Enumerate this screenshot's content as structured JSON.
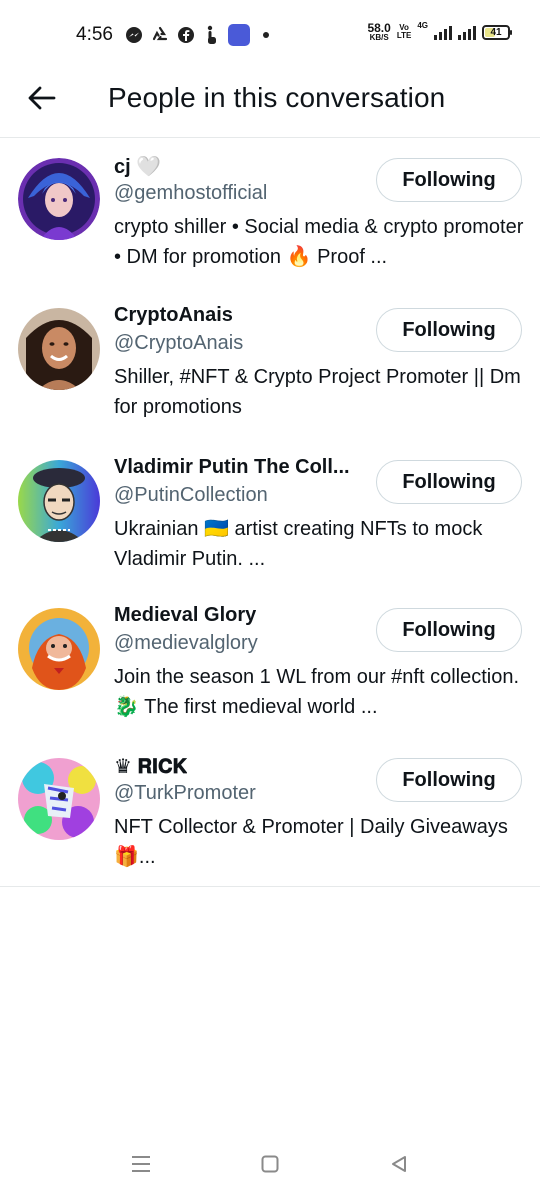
{
  "status_bar": {
    "time": "4:56",
    "net_speed": "58.0",
    "net_speed_unit": "KB/S",
    "volte_top": "Vo",
    "volte_bottom": "LTE",
    "network_type": "4G",
    "battery_level": "41",
    "battery_fraction": 0.41,
    "notification_icons": [
      "messenger-icon",
      "recycle-icon",
      "facebook-icon",
      "tap-hand-icon",
      "app-icon"
    ]
  },
  "header": {
    "title": "People in this conversation",
    "back_icon": "arrow-left-icon"
  },
  "colors": {
    "text_primary": "#0f1419",
    "text_secondary": "#536471",
    "button_border": "#cfd9de",
    "divider": "#e6e9ea"
  },
  "users": [
    {
      "name": "cj 🤍",
      "handle": "@gemhostofficial",
      "bio": "crypto shiller • Social media & crypto promoter • DM for promotion 🔥 Proof ...",
      "button": "Following",
      "avatar": "anime-avatar"
    },
    {
      "name": "CryptoAnais",
      "handle": "@CryptoAnais",
      "bio": "Shiller, #NFT & Crypto Project Promoter || Dm for promotions",
      "button": "Following",
      "avatar": "photo-avatar"
    },
    {
      "name": "Vladimir Putin The Coll...",
      "handle": "@PutinCollection",
      "bio": "Ukrainian 🇺🇦 artist creating NFTs to mock Vladimir Putin. ...",
      "button": "Following",
      "avatar": "cartoon-avatar"
    },
    {
      "name": "Medieval Glory",
      "handle": "@medievalglory",
      "bio": "Join the season 1 WL from our #nft collection. 🐉 The first medieval world ...",
      "button": "Following",
      "avatar": "medieval-avatar"
    },
    {
      "name": "♛ 𝐑𝐈𝐂𝐊",
      "handle": "@TurkPromoter",
      "bio": "NFT Collector & Promoter | Daily Giveaways 🎁...",
      "button": "Following",
      "avatar": "psychedelic-avatar"
    }
  ],
  "nav_bar": {
    "icons": [
      "menu-icon",
      "home-square-icon",
      "back-triangle-icon"
    ]
  }
}
